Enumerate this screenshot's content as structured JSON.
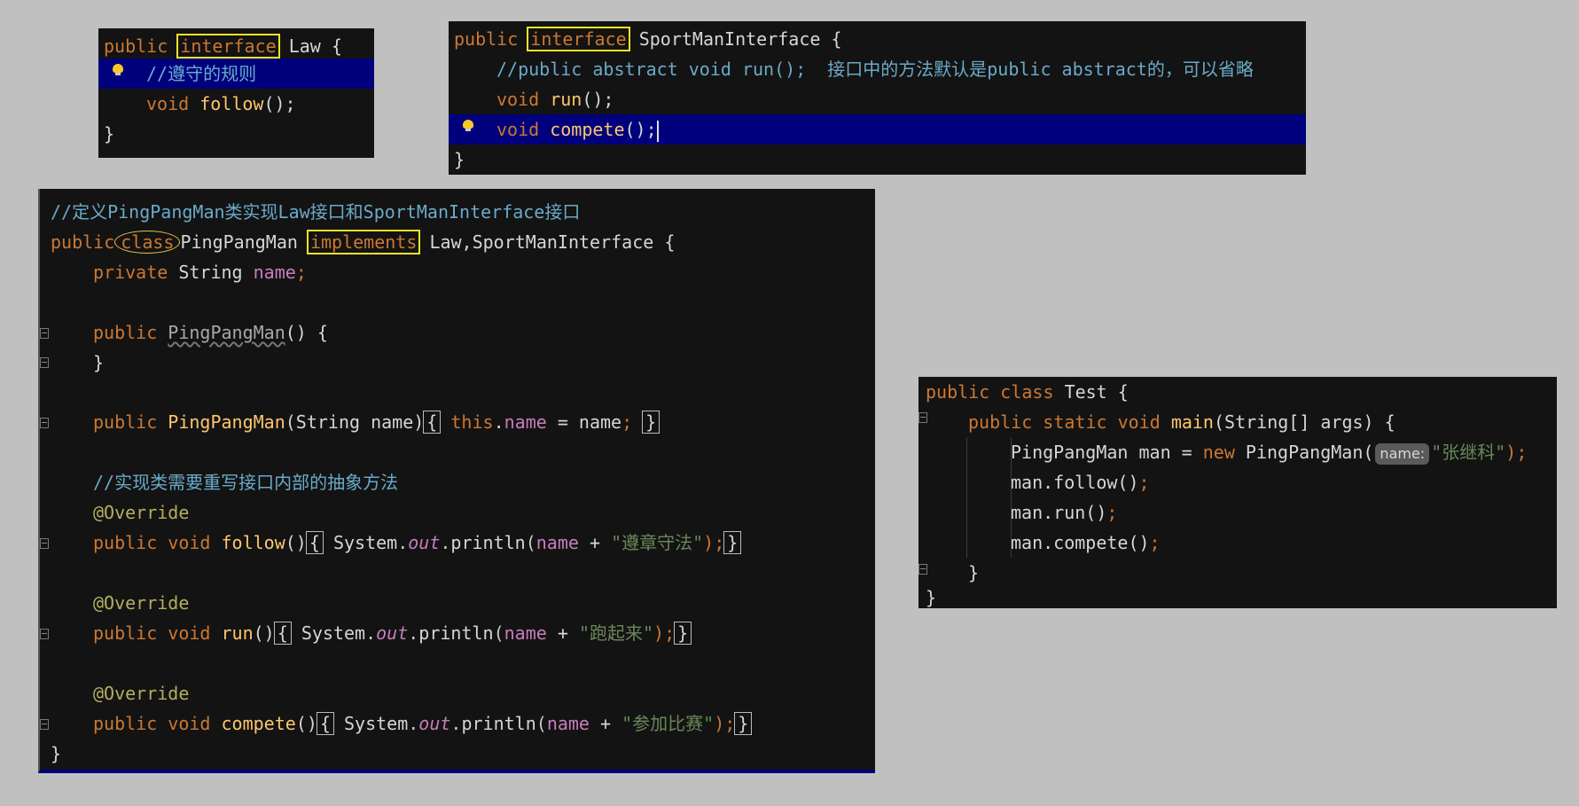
{
  "kw": {
    "public": "public",
    "interface": "interface",
    "class": "class",
    "implements": "implements",
    "private": "private",
    "void": "void",
    "static": "static",
    "new": "new",
    "this": "this",
    "abstract": "abstract"
  },
  "law_panel": {
    "name": "Law",
    "open": "{",
    "close": "}",
    "comment": "//遵守的规则",
    "method": "follow",
    "method_tail": "();"
  },
  "sport_panel": {
    "name": "SportManInterface",
    "open": "{",
    "close": "}",
    "comment": "//public abstract void run();  接口中的方法默认是public abstract的，可以省略",
    "method1": "run",
    "method1_tail": "();",
    "method2": "compete",
    "method2_tail": "();"
  },
  "ppm_panel": {
    "comment_top": "//定义PingPangMan类实现Law接口和SportManInterface接口",
    "class_name": "PingPangMan",
    "interfaces": "Law,SportManInterface",
    "open": "{",
    "close": "}",
    "type_string": "String",
    "field": "name",
    "semi": ";",
    "ctor_name": "PingPangMan",
    "empty_params": "()",
    "ctor2_params": "(String name)",
    "this_assign_dot": ".",
    "assign_eq": " = ",
    "assign_rhs": "name",
    "comment_override": "//实现类需要重写接口内部的抽象方法",
    "override": "@Override",
    "m_follow": "follow",
    "m_run": "run",
    "m_compete": "compete",
    "system": "System",
    "out": "out",
    "println": "println",
    "plus": " + ",
    "str_follow": "\"遵章守法\"",
    "str_run": "\"跑起来\"",
    "str_compete": "\"参加比赛\"",
    "call_tail": ");"
  },
  "test_panel": {
    "class_name": "Test",
    "open": "{",
    "close": "}",
    "main": "main",
    "main_params": "(String[] args)",
    "decl_type": "PingPangMan man = ",
    "ctor_call": "PingPangMan(",
    "param_hint": "name:",
    "arg": "\"张继科\"",
    "call_tail": ");",
    "call_follow": "man.follow()",
    "call_run": "man.run()",
    "call_compete": "man.compete()",
    "semi": ";"
  },
  "colors": {
    "background": "#c0c0c0",
    "editor_bg": "#131313",
    "keyword": "#cc7832",
    "function": "#ffc66d",
    "field": "#c77dbb",
    "comment": "#6aaac9",
    "string": "#6a8759",
    "annotation": "#b3ae60",
    "highlight_line": "#00007d",
    "yellow_box": "#f6e22b"
  },
  "icons": [
    "intention-bulb-icon",
    "fold-marker-icon"
  ]
}
